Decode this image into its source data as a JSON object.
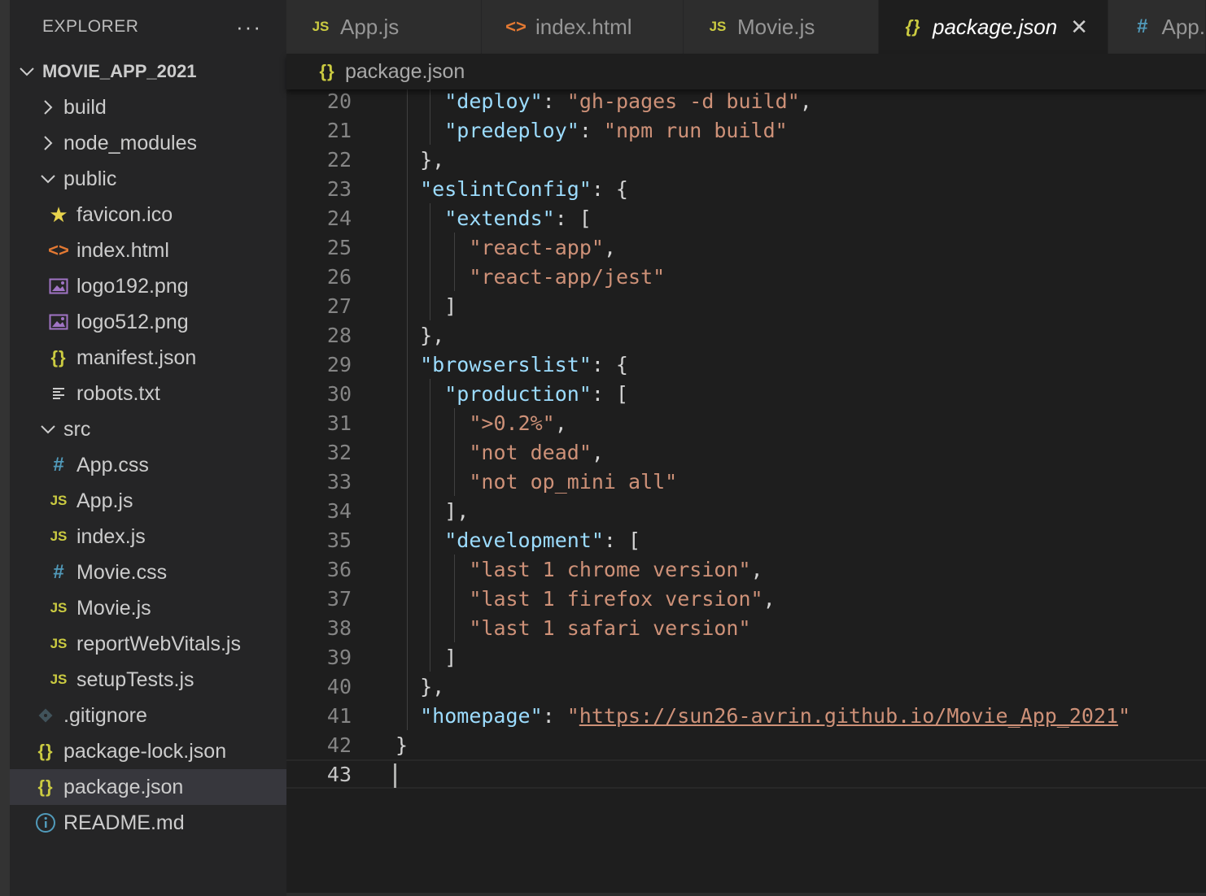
{
  "sidebar": {
    "title": "EXPLORER",
    "more": "···",
    "tree": [
      {
        "label": "MOVIE_APP_2021",
        "type": "folder-open",
        "depth": 0,
        "root": true
      },
      {
        "label": "build",
        "type": "folder-closed",
        "depth": 1
      },
      {
        "label": "node_modules",
        "type": "folder-closed",
        "depth": 1
      },
      {
        "label": "public",
        "type": "folder-open",
        "depth": 1
      },
      {
        "label": "favicon.ico",
        "icon": "star",
        "depth": 2
      },
      {
        "label": "index.html",
        "icon": "html",
        "depth": 2
      },
      {
        "label": "logo192.png",
        "icon": "img",
        "depth": 2
      },
      {
        "label": "logo512.png",
        "icon": "img",
        "depth": 2
      },
      {
        "label": "manifest.json",
        "icon": "json",
        "depth": 2
      },
      {
        "label": "robots.txt",
        "icon": "txt",
        "depth": 2
      },
      {
        "label": "src",
        "type": "folder-open",
        "depth": 1
      },
      {
        "label": "App.css",
        "icon": "css",
        "depth": 2
      },
      {
        "label": "App.js",
        "icon": "js",
        "depth": 2
      },
      {
        "label": "index.js",
        "icon": "js",
        "depth": 2
      },
      {
        "label": "Movie.css",
        "icon": "css",
        "depth": 2
      },
      {
        "label": "Movie.js",
        "icon": "js",
        "depth": 2
      },
      {
        "label": "reportWebVitals.js",
        "icon": "js",
        "depth": 2
      },
      {
        "label": "setupTests.js",
        "icon": "js",
        "depth": 2
      },
      {
        "label": ".gitignore",
        "icon": "git",
        "depth": 1
      },
      {
        "label": "package-lock.json",
        "icon": "json",
        "depth": 1
      },
      {
        "label": "package.json",
        "icon": "json",
        "depth": 1,
        "selected": true
      },
      {
        "label": "README.md",
        "icon": "info",
        "depth": 1
      }
    ]
  },
  "tabs": [
    {
      "label": "App.js",
      "icon": "js",
      "width": 240
    },
    {
      "label": "index.html",
      "icon": "html",
      "width": 248
    },
    {
      "label": "Movie.js",
      "icon": "js",
      "width": 240
    },
    {
      "label": "package.json",
      "icon": "json",
      "width": 282,
      "active": true,
      "close": "✕"
    },
    {
      "label": "App.",
      "icon": "css",
      "width": 120
    }
  ],
  "breadcrumb": {
    "label": "package.json",
    "icon": "json"
  },
  "editor": {
    "first_line": 20,
    "current_line": 43,
    "lines": [
      {
        "n": 20,
        "indent": 2,
        "tokens": [
          [
            "k",
            "\"deploy\""
          ],
          [
            "p",
            ": "
          ],
          [
            "s",
            "\"gh-pages -d build\""
          ],
          [
            "p",
            ","
          ]
        ]
      },
      {
        "n": 21,
        "indent": 2,
        "tokens": [
          [
            "k",
            "\"predeploy\""
          ],
          [
            "p",
            ": "
          ],
          [
            "s",
            "\"npm run build\""
          ]
        ]
      },
      {
        "n": 22,
        "indent": 1,
        "tokens": [
          [
            "p",
            "},"
          ]
        ]
      },
      {
        "n": 23,
        "indent": 1,
        "tokens": [
          [
            "k",
            "\"eslintConfig\""
          ],
          [
            "p",
            ": {"
          ]
        ]
      },
      {
        "n": 24,
        "indent": 2,
        "tokens": [
          [
            "k",
            "\"extends\""
          ],
          [
            "p",
            ": ["
          ]
        ]
      },
      {
        "n": 25,
        "indent": 3,
        "tokens": [
          [
            "s",
            "\"react-app\""
          ],
          [
            "p",
            ","
          ]
        ]
      },
      {
        "n": 26,
        "indent": 3,
        "tokens": [
          [
            "s",
            "\"react-app/jest\""
          ]
        ]
      },
      {
        "n": 27,
        "indent": 2,
        "tokens": [
          [
            "p",
            "]"
          ]
        ]
      },
      {
        "n": 28,
        "indent": 1,
        "tokens": [
          [
            "p",
            "},"
          ]
        ]
      },
      {
        "n": 29,
        "indent": 1,
        "tokens": [
          [
            "k",
            "\"browserslist\""
          ],
          [
            "p",
            ": {"
          ]
        ]
      },
      {
        "n": 30,
        "indent": 2,
        "tokens": [
          [
            "k",
            "\"production\""
          ],
          [
            "p",
            ": ["
          ]
        ]
      },
      {
        "n": 31,
        "indent": 3,
        "tokens": [
          [
            "s",
            "\">0.2%\""
          ],
          [
            "p",
            ","
          ]
        ]
      },
      {
        "n": 32,
        "indent": 3,
        "tokens": [
          [
            "s",
            "\"not dead\""
          ],
          [
            "p",
            ","
          ]
        ]
      },
      {
        "n": 33,
        "indent": 3,
        "tokens": [
          [
            "s",
            "\"not op_mini all\""
          ]
        ]
      },
      {
        "n": 34,
        "indent": 2,
        "tokens": [
          [
            "p",
            "],"
          ]
        ]
      },
      {
        "n": 35,
        "indent": 2,
        "tokens": [
          [
            "k",
            "\"development\""
          ],
          [
            "p",
            ": ["
          ]
        ]
      },
      {
        "n": 36,
        "indent": 3,
        "tokens": [
          [
            "s",
            "\"last 1 chrome version\""
          ],
          [
            "p",
            ","
          ]
        ]
      },
      {
        "n": 37,
        "indent": 3,
        "tokens": [
          [
            "s",
            "\"last 1 firefox version\""
          ],
          [
            "p",
            ","
          ]
        ]
      },
      {
        "n": 38,
        "indent": 3,
        "tokens": [
          [
            "s",
            "\"last 1 safari version\""
          ]
        ]
      },
      {
        "n": 39,
        "indent": 2,
        "tokens": [
          [
            "p",
            "]"
          ]
        ]
      },
      {
        "n": 40,
        "indent": 1,
        "tokens": [
          [
            "p",
            "},"
          ]
        ]
      },
      {
        "n": 41,
        "indent": 1,
        "tokens": [
          [
            "k",
            "\"homepage\""
          ],
          [
            "p",
            ": "
          ],
          [
            "s",
            "\""
          ],
          [
            "u",
            "https://sun26-avrin.github.io/Movie_App_2021"
          ],
          [
            "s",
            "\""
          ]
        ]
      },
      {
        "n": 42,
        "indent": 0,
        "tokens": [
          [
            "p",
            "}"
          ]
        ]
      },
      {
        "n": 43,
        "indent": 0,
        "tokens": []
      }
    ]
  },
  "colors": {
    "key": "#9cdcfe",
    "string": "#ce9178",
    "punct": "#d4d4d4",
    "js_icon": "#cbcb41",
    "css_icon": "#519aba",
    "html_icon": "#e37933"
  }
}
